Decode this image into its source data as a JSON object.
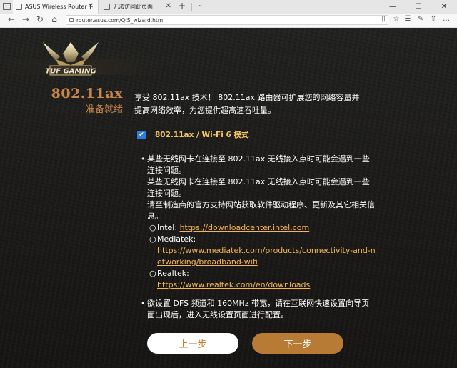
{
  "browser": {
    "tabs": [
      {
        "label": "ASUS Wireless Router T",
        "active": true
      },
      {
        "label": "无法访问此页面",
        "active": false
      }
    ],
    "new_tab_icon": "plus-icon",
    "url": "router.asus.com/QIS_wizard.htm"
  },
  "page": {
    "title": "802.11ax",
    "subtitle": "准备就绪",
    "description": "享受 802.11ax 技术！ 802.11ax 路由器可扩展您的网络容量并提高网络效率，为您提供超高速吞吐量。",
    "checkbox": {
      "label": "802.11ax / Wi-Fi 6 模式",
      "checked": true
    },
    "notes": {
      "line1": "某些无线网卡在连接至 802.11ax 无线接入点时可能会遇到一些连接问题。",
      "line2": "某些无线网卡在连接至 802.11ax 无线接入点时可能会遇到一些连接问题。",
      "line3": "请至制造商的官方支持网站获取软件驱动程序、更新及其它相关信息。",
      "vendors": [
        {
          "name": "Intel:",
          "url": "https://downloadcenter.intel.com"
        },
        {
          "name": "Mediatek:",
          "url": "https://www.mediatek.com/products/connectivity-and-networking/broadband-wifi"
        },
        {
          "name": "Realtek:",
          "url": "https://www.realtek.com/en/downloads"
        }
      ],
      "dfs_note": "欲设置 DFS 频道和 160MHz 带宽，请在互联网快速设置向导页面出现后，进入无线设置页面进行配置。"
    },
    "buttons": {
      "prev": "上一步",
      "next": "下一步"
    },
    "logo_text": "TUF GAMING"
  },
  "colors": {
    "accent": "#c8874a",
    "link": "#f5b458",
    "checkbox": "#2d7fd6",
    "background": "#1c1b19"
  }
}
